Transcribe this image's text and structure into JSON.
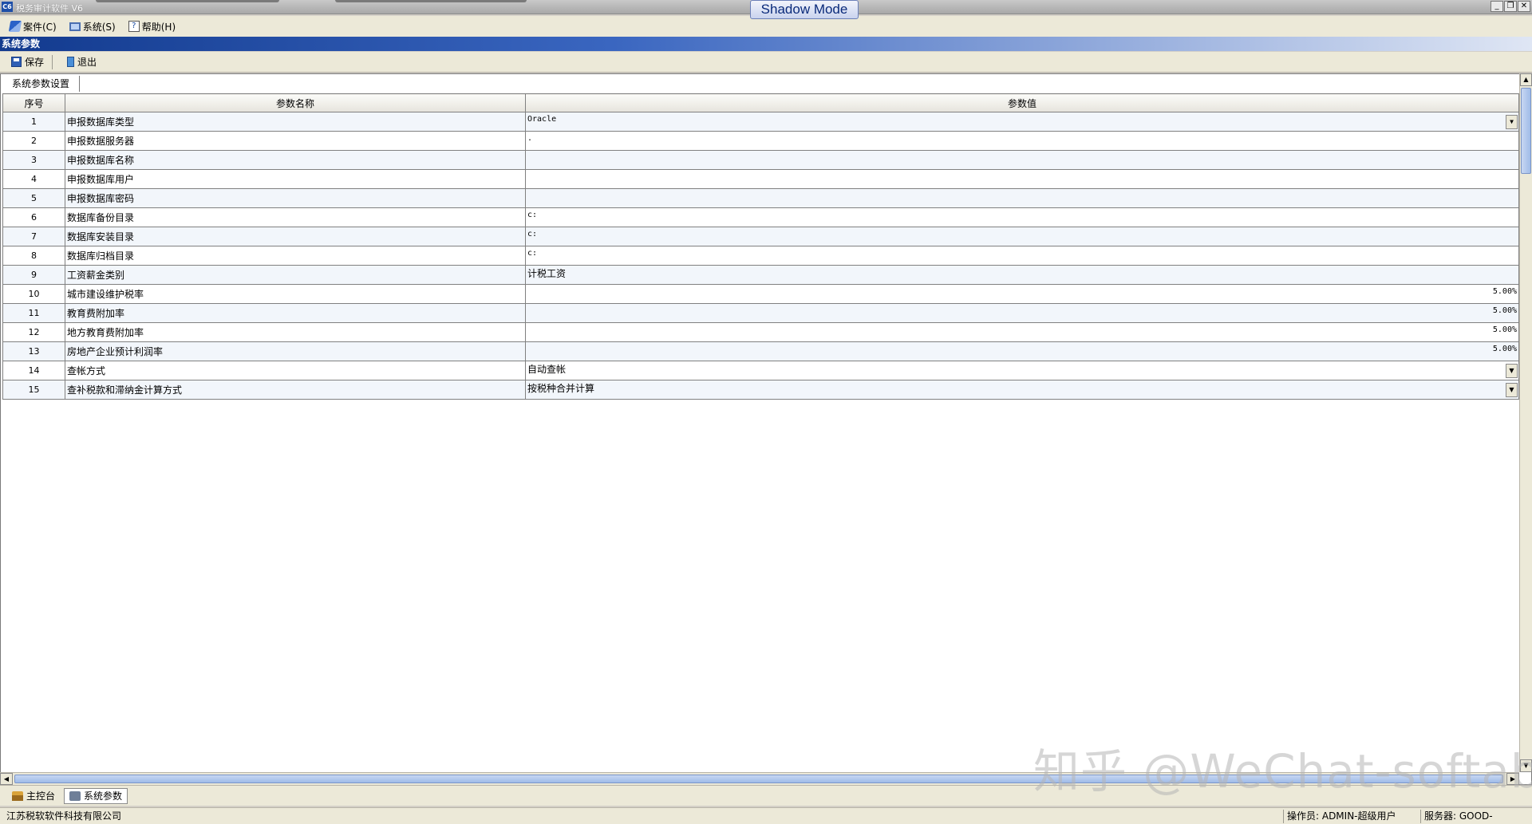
{
  "window": {
    "app_icon_text": "C6",
    "title": "税务审计软件 V6",
    "shadow_mode_label": "Shadow Mode",
    "controls": [
      "_",
      "❐",
      "✕"
    ]
  },
  "menu": [
    {
      "label": "案件(C)",
      "icon": "book-icon"
    },
    {
      "label": "系统(S)",
      "icon": "computer-icon"
    },
    {
      "label": "帮助(H)",
      "icon": "help-icon"
    }
  ],
  "caption": "系统参数",
  "toolbar": {
    "save_label": "保存",
    "exit_label": "退出"
  },
  "section_label": "系统参数设置",
  "table": {
    "headers": [
      "序号",
      "参数名称",
      "参数值"
    ],
    "rows": [
      {
        "seq": "1",
        "name": "申报数据库类型",
        "value": "Oracle",
        "align": "left",
        "dropdown": true
      },
      {
        "seq": "2",
        "name": "申报数据服务器",
        "value": ".",
        "align": "left",
        "dropdown": false
      },
      {
        "seq": "3",
        "name": "申报数据库名称",
        "value": "",
        "align": "left",
        "dropdown": false
      },
      {
        "seq": "4",
        "name": "申报数据库用户",
        "value": "",
        "align": "left",
        "dropdown": false
      },
      {
        "seq": "5",
        "name": "申报数据库密码",
        "value": "",
        "align": "left",
        "dropdown": false
      },
      {
        "seq": "6",
        "name": "数据库备份目录",
        "value": "c:",
        "align": "left",
        "dropdown": false
      },
      {
        "seq": "7",
        "name": "数据库安装目录",
        "value": "c:",
        "align": "left",
        "dropdown": false
      },
      {
        "seq": "8",
        "name": "数据库归档目录",
        "value": "c:",
        "align": "left",
        "dropdown": false
      },
      {
        "seq": "9",
        "name": "工资薪金类别",
        "value": "计税工资",
        "align": "cn",
        "dropdown": false
      },
      {
        "seq": "10",
        "name": "城市建设维护税率",
        "value": "5.00%",
        "align": "right",
        "dropdown": false
      },
      {
        "seq": "11",
        "name": "教育费附加率",
        "value": "5.00%",
        "align": "right",
        "dropdown": false
      },
      {
        "seq": "12",
        "name": "地方教育费附加率",
        "value": "5.00%",
        "align": "right",
        "dropdown": false
      },
      {
        "seq": "13",
        "name": "房地产企业预计利润率",
        "value": "5.00%",
        "align": "right",
        "dropdown": false
      },
      {
        "seq": "14",
        "name": "查帐方式",
        "value": "自动查帐",
        "align": "cn",
        "dropdown": true
      },
      {
        "seq": "15",
        "name": "查补税款和滞纳金计算方式",
        "value": "按税种合并计算",
        "align": "cn",
        "dropdown": true
      }
    ]
  },
  "tabs": [
    {
      "label": "主控台",
      "icon": "home-icon",
      "active": false
    },
    {
      "label": "系统参数",
      "icon": "settings-icon",
      "active": true
    }
  ],
  "status": {
    "company": "江苏税软软件科技有限公司",
    "operator": "操作员: ADMIN-超级用户",
    "server": "服务器: GOOD-PC\\TSSQL"
  },
  "watermark": "知乎 @WeChat-softab"
}
